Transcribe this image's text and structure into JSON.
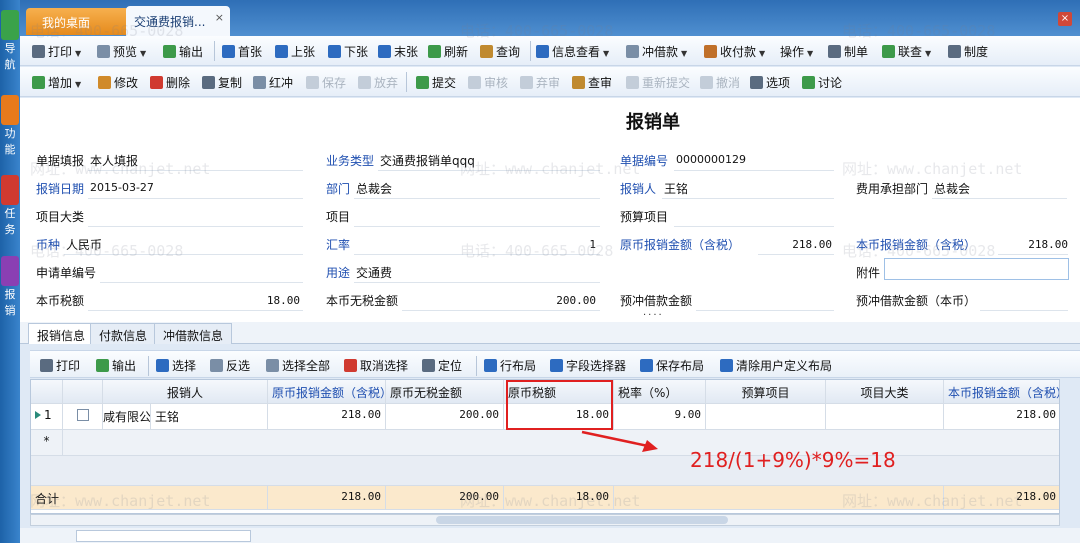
{
  "leftbar": {
    "items": [
      "导航",
      "功能",
      "任务",
      "报销"
    ]
  },
  "tabs": {
    "home": "我的桌面",
    "current": "交通费报销...",
    "close": "×"
  },
  "toolbar1": [
    {
      "label": "打印",
      "dd": true
    },
    {
      "label": "预览",
      "dd": true
    },
    {
      "label": "输出"
    },
    {
      "label": "首张"
    },
    {
      "label": "上张"
    },
    {
      "label": "下张"
    },
    {
      "label": "末张"
    },
    {
      "label": "刷新"
    },
    {
      "label": "查询"
    },
    {
      "label": "信息查看",
      "dd": true
    },
    {
      "label": "冲借款",
      "dd": true
    },
    {
      "label": "收付款",
      "dd": true
    },
    {
      "label": "操作",
      "dd": true
    },
    {
      "label": "制单"
    },
    {
      "label": "联查",
      "dd": true
    },
    {
      "label": "制度"
    }
  ],
  "toolbar2": [
    {
      "label": "增加",
      "dd": true
    },
    {
      "label": "修改"
    },
    {
      "label": "删除"
    },
    {
      "label": "复制"
    },
    {
      "label": "红冲"
    },
    {
      "label": "保存",
      "disabled": true
    },
    {
      "label": "放弃",
      "disabled": true
    },
    {
      "label": "提交"
    },
    {
      "label": "审核",
      "disabled": true
    },
    {
      "label": "弃审",
      "disabled": true
    },
    {
      "label": "查审"
    },
    {
      "label": "重新提交",
      "disabled": true
    },
    {
      "label": "撤消",
      "disabled": true
    },
    {
      "label": "选项"
    },
    {
      "label": "讨论"
    }
  ],
  "form": {
    "title": "报销单",
    "fields": {
      "fill_type_label": "单据填报",
      "fill_type_value": "本人填报",
      "biz_type_label": "业务类型",
      "biz_type_value": "交通费报销单qqq",
      "doc_no_label": "单据编号",
      "doc_no_value": "0000000129",
      "date_label": "报销日期",
      "date_value": "2015-03-27",
      "dept_label": "部门",
      "dept_value": "总裁会",
      "claimant_label": "报销人",
      "claimant_value": "王铭",
      "cost_dept_label": "费用承担部门",
      "cost_dept_value": "总裁会",
      "project_class_label": "项目大类",
      "project_label": "项目",
      "budget_item_label": "预算项目",
      "currency_label": "币种",
      "currency_value": "人民币",
      "rate_label": "汇率",
      "rate_value": "1",
      "orig_amount_label": "原币报销金额（含税）",
      "orig_amount_value": "218.00",
      "local_amount_label": "本币报销金额（含税）",
      "local_amount_value": "218.00",
      "apply_no_label": "申请单编号",
      "purpose_label": "用途",
      "purpose_value": "交通费",
      "attach_label": "附件",
      "local_tax_label": "本币税额",
      "local_tax_value": "18.00",
      "local_notax_label": "本币无税金额",
      "local_notax_value": "200.00",
      "prepay_label": "预冲借款金额",
      "prepay_local_label": "预冲借款金额（本币）",
      "dots": "····"
    }
  },
  "subtabs": [
    "报销信息",
    "付款信息",
    "冲借款信息"
  ],
  "grid_toolbar": [
    "打印",
    "输出",
    "选择",
    "反选",
    "选择全部",
    "取消选择",
    "定位",
    "行布局",
    "字段选择器",
    "保存布局",
    "清除用户定义布局"
  ],
  "grid": {
    "headers": [
      "",
      "",
      "报销人",
      "原币报销金额（含税）",
      "原币无税金额",
      "原币税额",
      "税率（%）",
      "预算项目",
      "项目大类",
      "本币报销金额（含税）"
    ],
    "row": {
      "index": "1",
      "company": "咸有限公司",
      "claimant": "王铭",
      "orig_amount": "218.00",
      "orig_notax": "200.00",
      "orig_tax": "18.00",
      "tax_rate": "9.00",
      "local_amount": "218.00"
    },
    "new_row_marker": "*",
    "sum": {
      "label": "合计",
      "orig_amount": "218.00",
      "orig_notax": "200.00",
      "orig_tax": "18.00",
      "local_amount": "218.00"
    }
  },
  "annotation": {
    "formula": "218/(1+9%)*9%=18",
    "color": "#e02020"
  },
  "watermark": {
    "phone": "电话：400-665-0028",
    "url": "网址：www.chanjet.net"
  }
}
